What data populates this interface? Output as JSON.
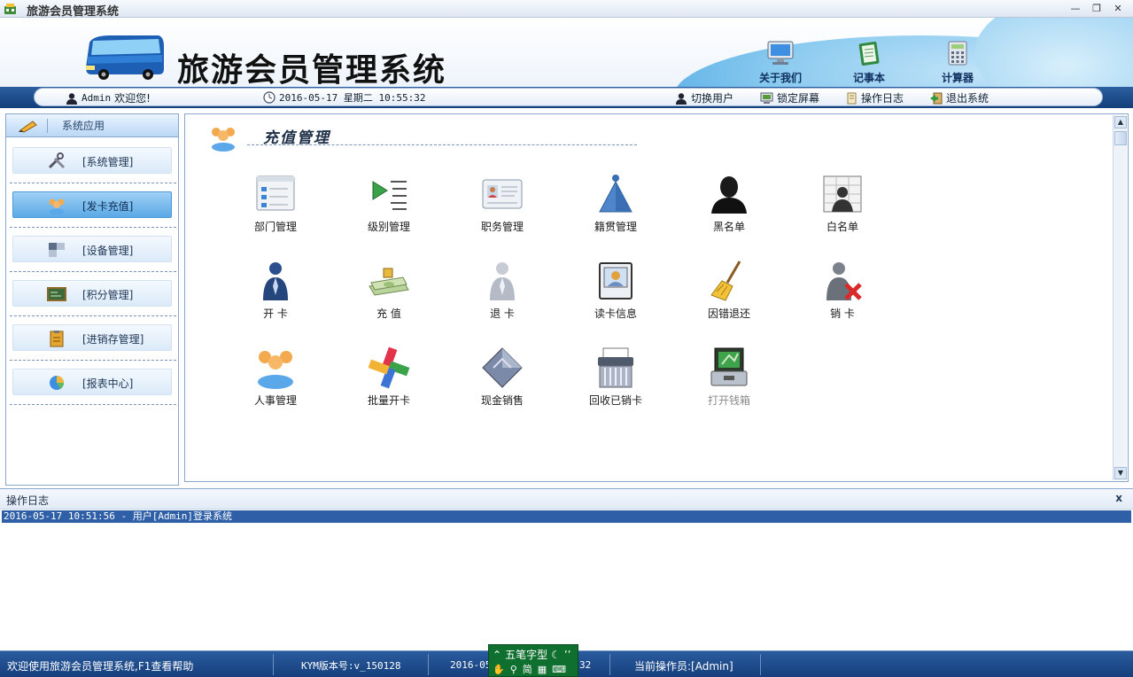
{
  "window": {
    "title": "旅游会员管理系统"
  },
  "banner": {
    "app_name": "旅游会员管理系统",
    "tools": [
      {
        "label": "关于我们",
        "icon": "monitor-icon"
      },
      {
        "label": "记事本",
        "icon": "notepad-icon"
      },
      {
        "label": "计算器",
        "icon": "calculator-icon"
      }
    ]
  },
  "infobar": {
    "user": "Admin",
    "welcome": "欢迎您!",
    "datetime": "2016-05-17 星期二 10:55:32",
    "actions": [
      "切换用户",
      "锁定屏幕",
      "操作日志",
      "退出系统"
    ]
  },
  "sidebar": {
    "header": "系统应用",
    "items": [
      {
        "label": "[系统管理]",
        "icon": "tools-icon",
        "active": false
      },
      {
        "label": "[发卡充值]",
        "icon": "users-icon",
        "active": true
      },
      {
        "label": "[设备管理]",
        "icon": "device-icon",
        "active": false
      },
      {
        "label": "[积分管理]",
        "icon": "scoreboard-icon",
        "active": false
      },
      {
        "label": "[进销存管理]",
        "icon": "clipboard-icon",
        "active": false
      },
      {
        "label": "[报表中心]",
        "icon": "pie-chart-icon",
        "active": false
      }
    ]
  },
  "content": {
    "section_title": "充值管理",
    "tiles": [
      {
        "label": "部门管理",
        "icon": "department-icon",
        "enabled": true
      },
      {
        "label": "级别管理",
        "icon": "level-icon",
        "enabled": true
      },
      {
        "label": "职务管理",
        "icon": "id-card-icon",
        "enabled": true
      },
      {
        "label": "籍贯管理",
        "icon": "origin-icon",
        "enabled": true
      },
      {
        "label": "黑名单",
        "icon": "blacklist-icon",
        "enabled": true
      },
      {
        "label": "白名单",
        "icon": "whitelist-icon",
        "enabled": true
      },
      {
        "label": "开 卡",
        "icon": "open-card-icon",
        "enabled": true
      },
      {
        "label": "充 值",
        "icon": "money-icon",
        "enabled": true
      },
      {
        "label": "退 卡",
        "icon": "return-card-icon",
        "enabled": true
      },
      {
        "label": "读卡信息",
        "icon": "card-reader-icon",
        "enabled": true
      },
      {
        "label": "因错退还",
        "icon": "broom-icon",
        "enabled": true
      },
      {
        "label": "销 卡",
        "icon": "cancel-card-icon",
        "enabled": true
      },
      {
        "label": "人事管理",
        "icon": "personnel-icon",
        "enabled": true
      },
      {
        "label": "批量开卡",
        "icon": "batch-card-icon",
        "enabled": true
      },
      {
        "label": "现金销售",
        "icon": "cash-sale-icon",
        "enabled": true
      },
      {
        "label": "回收已销卡",
        "icon": "shredder-icon",
        "enabled": true
      },
      {
        "label": "打开钱箱",
        "icon": "cash-box-icon",
        "enabled": false
      }
    ]
  },
  "log": {
    "title": "操作日志",
    "close_label": "x",
    "entries": [
      "2016-05-17 10:51:56 - 用户[Admin]登录系统"
    ]
  },
  "status": {
    "message": "欢迎使用旅游会员管理系统,F1查看帮助",
    "version": "KYM版本号:v_150128",
    "date_partial": "2016-05",
    "time_partial": "32",
    "operator": "当前操作员:[Admin]"
  },
  "ime": {
    "name": "五笔字型",
    "mode": "简"
  },
  "colors": {
    "accent": "#2d5fa0",
    "active_nav": "#5aa9e6",
    "log_selected": "#2f5fa6"
  }
}
